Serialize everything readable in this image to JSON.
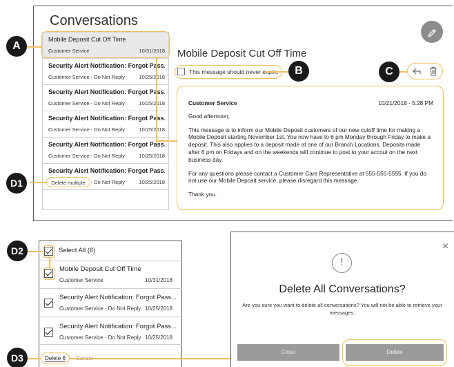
{
  "conversations": {
    "title": "Conversations",
    "items": [
      {
        "subject": "Mobile Deposit Cut Off Time",
        "sender": "Customer Service",
        "date": "10/31/2018"
      },
      {
        "subject": "Security Alert Notification: Forgot Pass...",
        "sender": "Customer Service - Do Not Reply",
        "date": "10/25/2018"
      },
      {
        "subject": "Security Alert Notification: Forgot Pass...",
        "sender": "Customer Service - Do Not Reply",
        "date": "10/25/2018"
      },
      {
        "subject": "Security Alert Notification: Forgot Pass...",
        "sender": "Customer Service - Do Not Reply",
        "date": "10/25/2018"
      },
      {
        "subject": "Security Alert Notification: Forgot Pass...",
        "sender": "Customer Service - Do Not Reply",
        "date": "10/25/2018"
      },
      {
        "subject": "Security Alert Notification: Forgot Pass...",
        "sender": "Customer Service - Do Not Reply",
        "date": "10/25/2018"
      }
    ],
    "delete_multiple": "Delete multiple"
  },
  "message": {
    "title": "Mobile Deposit Cut Off Time",
    "never_expire_label": "This message should never expire",
    "sender": "Customer Service",
    "timestamp": "10/21/2018 - 5:28 PM",
    "greeting": "Good afternoon,",
    "paragraph1": "This message is to inform our Mobile Deposit customers of our new cutoff time for making a Mobile Deposit starting November 1st. You now have to 6 pm Monday through Friday to make a deposit. This also applies to a deposit made at one of our Branch Locations. Deposits made after 6 pm on Fridays and on the weekends will continue to post to your accout on the next business day.",
    "paragraph2": "For any questions please contact a Customer Care Representative at 555-555-5555. If you do not use our Mobile Deposit service, please disregard this message.",
    "signoff": "Thank you."
  },
  "markers": {
    "a": "A",
    "b": "B",
    "c": "C",
    "d1": "D1",
    "d2": "D2",
    "d3": "D3"
  },
  "select_panel": {
    "select_all": "Select All (6)",
    "items": [
      {
        "subject": "Mobile Deposit Cut Off Time",
        "sender": "Customer Service",
        "date": "10/31/2018"
      },
      {
        "subject": "Security Alert Notification: Forgot Pass...",
        "sender": "Customer Service - Do Not Reply",
        "date": "10/25/2018"
      },
      {
        "subject": "Security Alert Notification: Forgot Pass...",
        "sender": "Customer Service - Do Not Reply",
        "date": "10/25/2018"
      }
    ],
    "delete_button": "Delete 6",
    "cancel_link": "Cancel"
  },
  "dialog": {
    "warning_glyph": "!",
    "close_glyph": "×",
    "title": "Delete All Conversations?",
    "body": "Are you sure you want to delete all conversations? You will not be able to retrieve your messages.",
    "close_button": "Close",
    "delete_button": "Delete"
  },
  "colors": {
    "highlight": "#f0c060",
    "marker": "#1a1a1a",
    "button": "#9a9a9a"
  }
}
